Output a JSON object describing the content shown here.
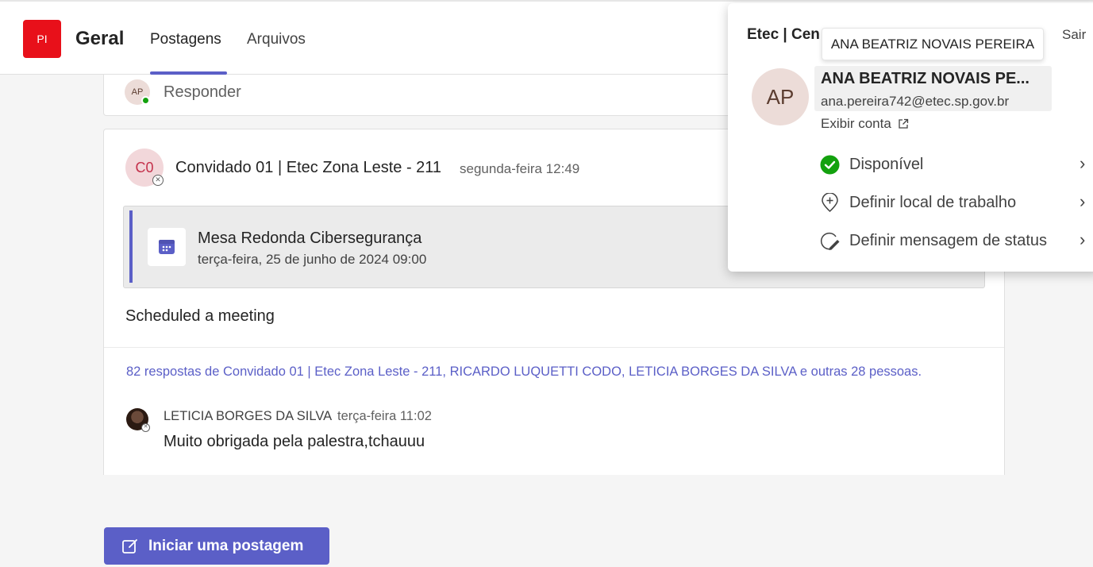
{
  "header": {
    "team_initials": "PI",
    "channel_name": "Geral",
    "tabs": [
      {
        "label": "Postagens",
        "active": true
      },
      {
        "label": "Arquivos",
        "active": false
      }
    ]
  },
  "reply_box": {
    "avatar_initials": "AP",
    "label": "Responder"
  },
  "post": {
    "avatar_initials": "C0",
    "author": "Convidado 01 | Etec Zona Leste - 211",
    "time": "segunda-feira 12:49",
    "meeting": {
      "title": "Mesa Redonda Cibersegurança",
      "date": "terça-feira, 25 de junho de 2024 09:00"
    },
    "body": "Scheduled a meeting",
    "replies_summary": "82 respostas de Convidado 01 | Etec Zona Leste - 211, RICARDO LUQUETTI CODO, LETICIA BORGES DA SILVA e outras 28 pessoas.",
    "latest_reply": {
      "author": "LETICIA BORGES DA SILVA",
      "time": "terça-feira 11:02",
      "message": "Muito obrigada pela palestra,tchauuu"
    }
  },
  "new_post_button": "Iniciar uma postagem",
  "profile_flyout": {
    "org_name": "Etec | Cen",
    "sign_out": "Sair",
    "tooltip": "ANA BEATRIZ NOVAIS PEREIRA",
    "avatar_initials": "AP",
    "display_name": "ANA BEATRIZ NOVAIS PE...",
    "email": "ana.pereira742@etec.sp.gov.br",
    "view_account": "Exibir conta",
    "menu": [
      {
        "label": "Disponível",
        "icon": "available-check-icon"
      },
      {
        "label": "Definir local de trabalho",
        "icon": "location-pin-icon"
      },
      {
        "label": "Definir mensagem de status",
        "icon": "status-message-icon"
      }
    ]
  },
  "colors": {
    "accent": "#5b5fc7",
    "team_avatar": "#e8101a",
    "available": "#13a10e"
  }
}
